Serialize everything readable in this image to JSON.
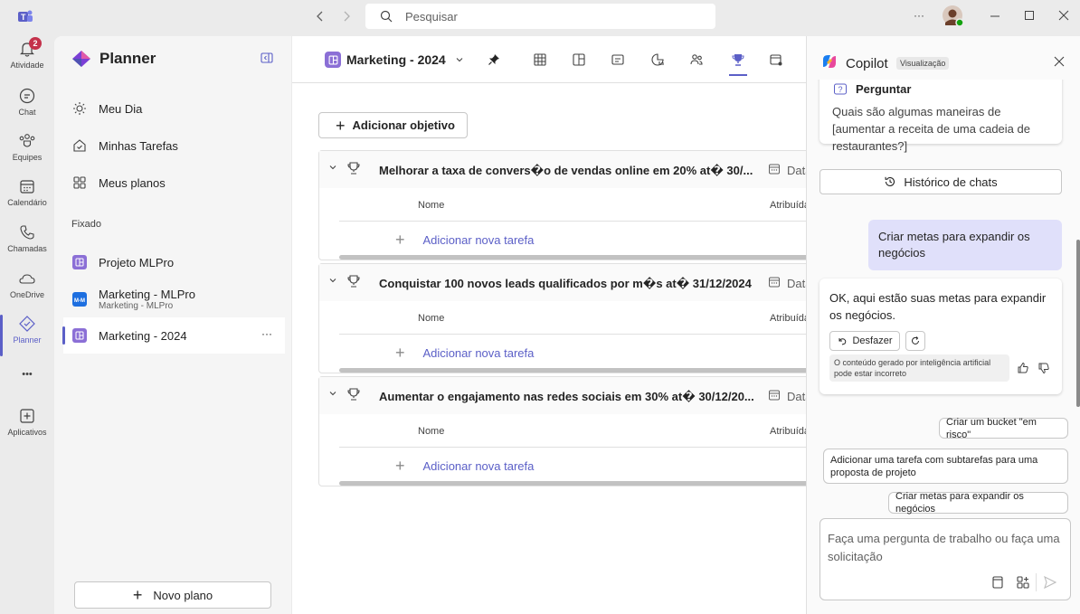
{
  "titlebar": {
    "search_placeholder": "Pesquisar",
    "more": "···"
  },
  "rail": {
    "activity": "Atividade",
    "activity_badge": "2",
    "chat": "Chat",
    "teams": "Equipes",
    "calendar": "Calendário",
    "calls": "Chamadas",
    "onedrive": "OneDrive",
    "planner": "Planner",
    "more": "•••",
    "apps": "Aplicativos"
  },
  "sidebar": {
    "brand": "Planner",
    "nav": {
      "my_day": "Meu Dia",
      "my_tasks": "Minhas Tarefas",
      "my_plans": "Meus planos"
    },
    "pinned_header": "Fixado",
    "pinned": [
      {
        "name": "Projeto MLPro"
      },
      {
        "name": "Marketing - MLPro",
        "sub": "Marketing - MLPro"
      },
      {
        "name": "Marketing - 2024",
        "more": "···"
      }
    ],
    "new_plan": "Novo plano"
  },
  "main": {
    "plan_title": "Marketing - 2024",
    "add_goal": "Adicionar objetivo",
    "goals": [
      {
        "title": "Melhorar a taxa de convers�o de vendas online em 20% at� 30/...",
        "date_label": "Data",
        "col_name": "Nome",
        "col_assign": "Atribuída",
        "add_task": "Adicionar nova tarefa"
      },
      {
        "title": "Conquistar 100 novos leads qualificados por m�s at� 31/12/2024",
        "date_label": "Data",
        "col_name": "Nome",
        "col_assign": "Atribuída",
        "add_task": "Adicionar nova tarefa"
      },
      {
        "title": "Aumentar o engajamento nas redes sociais em 30% at� 30/12/20...",
        "date_label": "Data",
        "col_name": "Nome",
        "col_assign": "Atribuída",
        "add_task": "Adicionar nova tarefa"
      }
    ]
  },
  "copilot": {
    "title": "Copilot",
    "preview": "Visualização",
    "ask_label": "Perguntar",
    "ask_question": "Quais são algumas maneiras de [aumentar a receita de uma cadeia de restaurantes?]",
    "history": "Histórico de chats",
    "user_message": "Criar metas para expandir os negócios",
    "bot_message": "OK, aqui estão suas metas para expandir os negócios.",
    "undo": "Desfazer",
    "disclaimer": "O conteúdo gerado por inteligência artificial pode estar incorreto",
    "suggestions": [
      "Criar um bucket \"em risco\"",
      "Adicionar uma tarefa com subtarefas para uma proposta de projeto",
      "Criar metas para expandir os negócios"
    ],
    "input_placeholder": "Faça uma pergunta de trabalho ou faça uma solicitação"
  },
  "colors": {
    "accent": "#5b5fc7",
    "plan_icon": "#8b6fd6",
    "badge": "#c4314b",
    "user_bubble": "#e0e0fa"
  }
}
